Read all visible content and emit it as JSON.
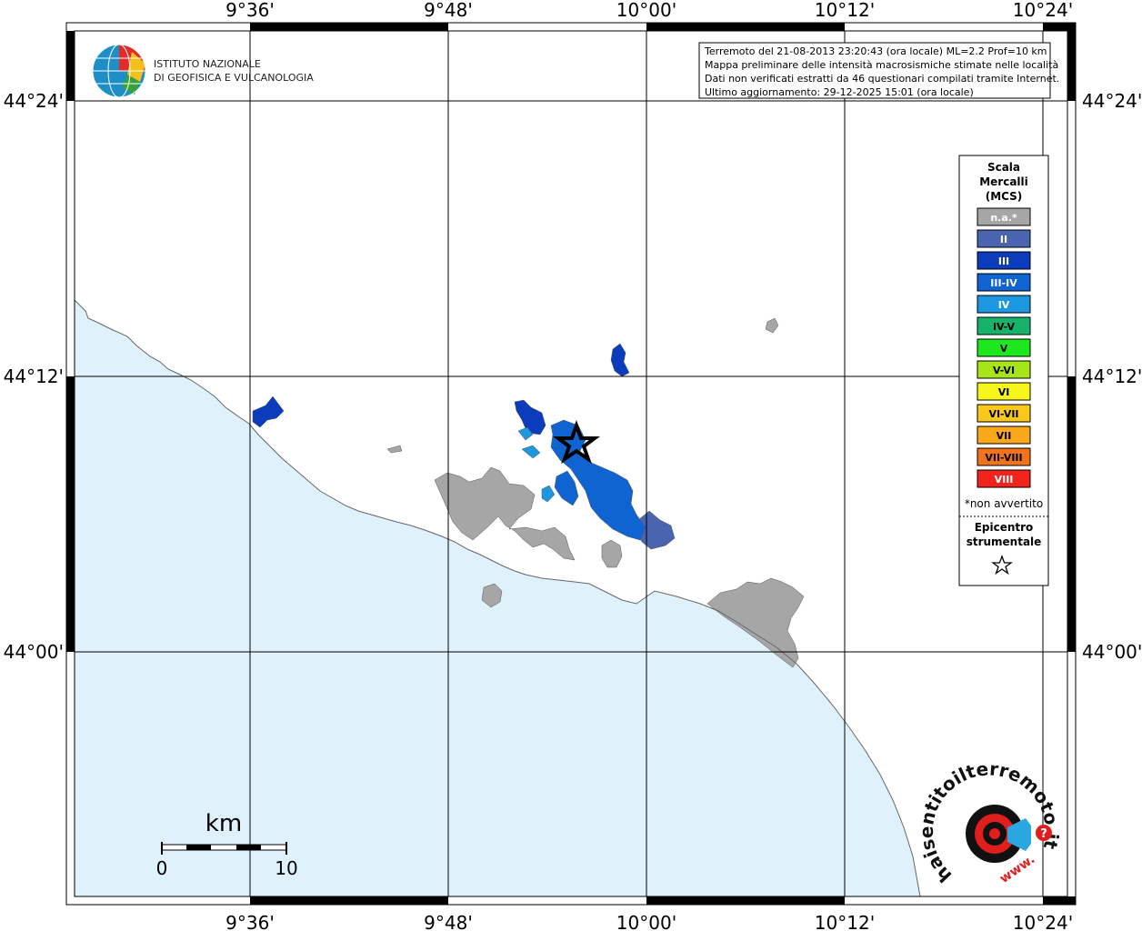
{
  "map": {
    "top_lon_labels": [
      "9°36'",
      "9°48'",
      "10°00'",
      "10°12'",
      "10°24'"
    ],
    "bottom_lon_labels": [
      "9°36'",
      "9°48'",
      "10°00'",
      "10°12'",
      "10°24'"
    ],
    "left_lat_labels": [
      "44°24'",
      "44°12'",
      "44°00'"
    ],
    "right_lat_labels": [
      "44°24'",
      "44°12'",
      "44°00'"
    ],
    "colors": {
      "sea": "#dff2fc",
      "land": "#ffffff",
      "na": "#a6a6a6",
      "II": "#4a64b0",
      "III": "#0a3cbc",
      "III-IV": "#0f64d2",
      "IV": "#1d98e0",
      "epicenter_stroke": "#000000"
    }
  },
  "institute": {
    "line1": "ISTITUTO NAZIONALE",
    "line2": "DI GEOFISICA E VULCANOLOGIA"
  },
  "info_box": {
    "lines": [
      "Terremoto del 21-08-2013 23:20:43 (ora locale) ML=2.2 Prof=10 km",
      "Mappa preliminare delle intensità macrosismiche stimate nelle località",
      "Dati non verificati estratti da 46 questionari compilati tramite Internet.",
      "Ultimo aggiornamento: 29-12-2025 15:01 (ora locale)"
    ]
  },
  "legend": {
    "title_lines": [
      "Scala",
      "Mercalli",
      "(MCS)"
    ],
    "items": [
      {
        "label": "n.a.*",
        "color": "#a6a6a6",
        "text_color": "#ffffff"
      },
      {
        "label": "II",
        "color": "#4a64b0",
        "text_color": "#ffffff"
      },
      {
        "label": "III",
        "color": "#0a3cbc",
        "text_color": "#ffffff"
      },
      {
        "label": "III-IV",
        "color": "#0f64d2",
        "text_color": "#ffffff"
      },
      {
        "label": "IV",
        "color": "#1d98e0",
        "text_color": "#ffffff"
      },
      {
        "label": "IV-V",
        "color": "#17b36b",
        "text_color": "#000000"
      },
      {
        "label": "V",
        "color": "#1de81d",
        "text_color": "#000000"
      },
      {
        "label": "V-VI",
        "color": "#a6e619",
        "text_color": "#000000"
      },
      {
        "label": "VI",
        "color": "#f6f61b",
        "text_color": "#000000"
      },
      {
        "label": "VI-VII",
        "color": "#f8c91b",
        "text_color": "#000000"
      },
      {
        "label": "VII",
        "color": "#f8a81b",
        "text_color": "#000000"
      },
      {
        "label": "VII-VIII",
        "color": "#f2731c",
        "text_color": "#000000"
      },
      {
        "label": "VIII",
        "color": "#f2221c",
        "text_color": "#ffffff"
      }
    ],
    "note": "*non avvertito",
    "epicenter_lines": [
      "Epicentro",
      "strumentale"
    ],
    "epicenter_symbol": "star-icon"
  },
  "scale_bar": {
    "unit": "km",
    "start_label": "0",
    "end_label": "10"
  },
  "brand": {
    "site_name": "haisentitoilterremoto.it",
    "prefix": "www."
  }
}
